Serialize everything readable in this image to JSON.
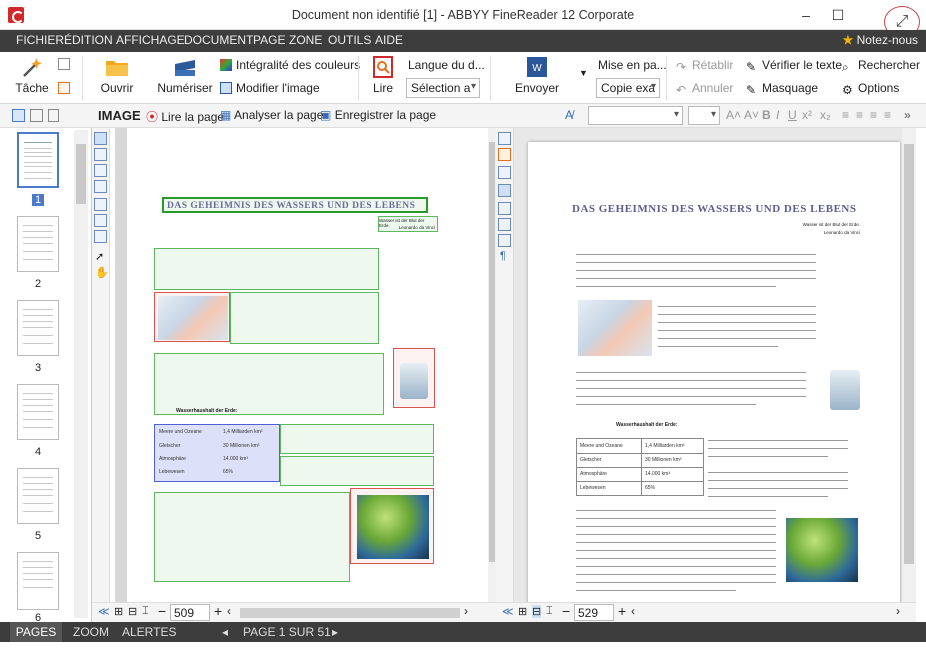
{
  "window": {
    "title": "Document non identifié [1] - ABBYY FineReader 12 Corporate"
  },
  "menu": [
    "FICHIER",
    "ÉDITION",
    "AFFICHAGE",
    "DOCUMENT",
    "PAGE",
    "ZONE",
    "OUTILS",
    "AIDE"
  ],
  "notez": "Notez-nous",
  "ribbon": {
    "task": "Tâche",
    "open": "Ouvrir",
    "scan": "Numériser",
    "full_color": "Intégralité des couleurs",
    "edit_image": "Modifier l'image",
    "read": "Lire",
    "lang_label": "Langue du d...",
    "lang_value": "Sélection a",
    "send": "Envoyer",
    "layout_label": "Mise en pa...",
    "layout_value": "Copie exa",
    "restore": "Rétablir",
    "cancel": "Annuler",
    "verify": "Vérifier le texte",
    "masking": "Masquage",
    "search": "Rechercher",
    "options": "Options"
  },
  "imgtoolbar": {
    "title": "IMAGE",
    "read_page": "Lire la page",
    "analyze_page": "Analyser la page",
    "save_page": "Enregistrer la page"
  },
  "thumbs": [
    "1",
    "2",
    "3",
    "4",
    "5",
    "6"
  ],
  "image_zoom": "509",
  "text_zoom": "529",
  "status": {
    "pages": "PAGES",
    "zoom": "ZOOM",
    "alerts": "ALERTES",
    "page_info": "PAGE 1 SUR 51"
  },
  "doc": {
    "title": "DAS GEHEIMNIS DES WASSERS UND DES LEBENS",
    "epigraph1": "Wasser ist der Blut der Erde.",
    "epigraph2": "Leonardo da Vinci",
    "subhead": "Wasserhaushalt der Erde:",
    "table": [
      [
        "Meere und Ozeane",
        "1,4 Milliarden km³"
      ],
      [
        "Gletscher",
        "30 Millionen km³"
      ],
      [
        "Atmosphäre",
        "14.000 km³"
      ],
      [
        "Lebewesen",
        "65%"
      ]
    ]
  },
  "colors": {
    "menubar": "#3d3d3d",
    "accent": "#d0282b",
    "green_block": "#5cb85c",
    "red_block": "#d9534f",
    "table_block": "#5060d0"
  }
}
